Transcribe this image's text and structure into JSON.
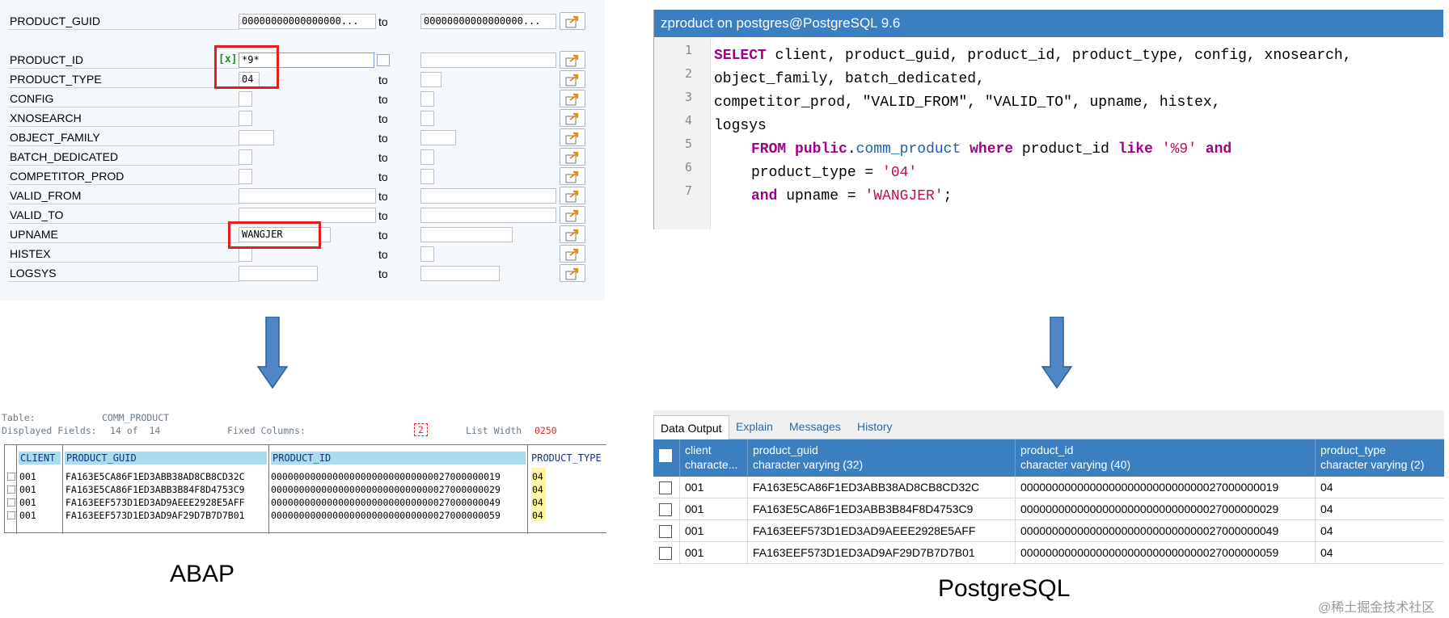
{
  "abap_selection": {
    "fields": [
      {
        "label": "PRODUCT_GUID",
        "low": "00000000000000000...",
        "high": "00000000000000000..."
      },
      {
        "label": "PRODUCT_ID",
        "low": "*9*",
        "high": ""
      },
      {
        "label": "PRODUCT_TYPE",
        "low": "04",
        "high": ""
      },
      {
        "label": "CONFIG",
        "low": "",
        "high": ""
      },
      {
        "label": "XNOSEARCH",
        "low": "",
        "high": ""
      },
      {
        "label": "OBJECT_FAMILY",
        "low": "",
        "high": ""
      },
      {
        "label": "BATCH_DEDICATED",
        "low": "",
        "high": ""
      },
      {
        "label": "COMPETITOR_PROD",
        "low": "",
        "high": ""
      },
      {
        "label": "VALID_FROM",
        "low": "",
        "high": ""
      },
      {
        "label": "VALID_TO",
        "low": "",
        "high": ""
      },
      {
        "label": "UPNAME",
        "low": "WANGJER",
        "high": ""
      },
      {
        "label": "HISTEX",
        "low": "",
        "high": ""
      },
      {
        "label": "LOGSYS",
        "low": "",
        "high": ""
      }
    ],
    "to_label": "to",
    "check_icon_text": "[x]"
  },
  "sql_editor": {
    "title": "zproduct on postgres@PostgreSQL 9.6",
    "line_numbers": [
      "1",
      "2",
      "3",
      "4",
      "5",
      "6",
      "7"
    ],
    "lines": {
      "l1_kw": "SELECT",
      "l1_rest": " client, product_guid, product_id, product_type, config, xnosearch,",
      "l2": "object_family, batch_dedicated,",
      "l3": "competitor_prod, \"VALID_FROM\", \"VALID_TO\", upname, histex,",
      "l4": "logsys",
      "l5_from": "FROM",
      "l5_public": "public",
      "l5_dot": ".",
      "l5_table": "comm_product",
      "l5_where": "where",
      "l5_col": "product_id",
      "l5_like": "like",
      "l5_str": "'%9'",
      "l5_and": "and",
      "l6_col": "product_type = ",
      "l6_str": "'04'",
      "l7_and": "and",
      "l7_col": " upname = ",
      "l7_str": "'WANGJER'",
      "l7_end": ";"
    }
  },
  "abap_list": {
    "table_label": "Table:",
    "table_name": "COMM_PRODUCT",
    "displayed_label": "Displayed Fields:",
    "displayed_value": "14 of  14",
    "fixed_label": "Fixed Columns:",
    "fixed_value": "2",
    "width_label": "List Width",
    "width_value": "0250",
    "columns": [
      "CLIENT",
      "PRODUCT_GUID",
      "PRODUCT_ID",
      "PRODUCT_TYPE"
    ],
    "rows": [
      [
        "001",
        "FA163E5CA86F1ED3ABB38AD8CB8CD32C",
        "00000000000000000000000000000027000000019",
        "04"
      ],
      [
        "001",
        "FA163E5CA86F1ED3ABB3B84F8D4753C9",
        "00000000000000000000000000000027000000029",
        "04"
      ],
      [
        "001",
        "FA163EEF573D1ED3AD9AEEE2928E5AFF",
        "00000000000000000000000000000027000000049",
        "04"
      ],
      [
        "001",
        "FA163EEF573D1ED3AD9AF29D7B7D7B01",
        "00000000000000000000000000000027000000059",
        "04"
      ]
    ]
  },
  "pg_output": {
    "tabs": [
      "Data Output",
      "Explain",
      "Messages",
      "History"
    ],
    "columns": [
      {
        "name": "client",
        "type": "characte..."
      },
      {
        "name": "product_guid",
        "type": "character varying (32)"
      },
      {
        "name": "product_id",
        "type": "character varying (40)"
      },
      {
        "name": "product_type",
        "type": "character varying (2)"
      }
    ],
    "rows": [
      [
        "001",
        "FA163E5CA86F1ED3ABB38AD8CB8CD32C",
        "00000000000000000000000000000027000000019",
        "04"
      ],
      [
        "001",
        "FA163E5CA86F1ED3ABB3B84F8D4753C9",
        "00000000000000000000000000000027000000029",
        "04"
      ],
      [
        "001",
        "FA163EEF573D1ED3AD9AEEE2928E5AFF",
        "00000000000000000000000000000027000000049",
        "04"
      ],
      [
        "001",
        "FA163EEF573D1ED3AD9AF29D7B7D7B01",
        "00000000000000000000000000000027000000059",
        "04"
      ]
    ]
  },
  "captions": {
    "abap": "ABAP",
    "postgres": "PostgreSQL"
  },
  "watermark": "@稀土掘金技术社区",
  "colors": {
    "accent": "#3c7fc0",
    "highlight": "#e02020",
    "keyword": "#a0008c",
    "string": "#b8144a"
  }
}
